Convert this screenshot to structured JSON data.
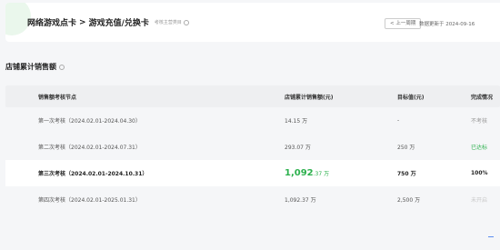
{
  "header": {
    "breadcrumb": [
      "网络游戏点卡",
      "游戏充值/兑换卡"
    ],
    "separator": ">",
    "tag": "考核主营类目",
    "prev_button": "< 上一周期",
    "update_text": "数据更新于 2024-09-16"
  },
  "section": {
    "title": "店铺累计销售额"
  },
  "table": {
    "columns": [
      "销售额考核节点",
      "店铺累计销售额(元)",
      "目标值(元)",
      "完成情况"
    ],
    "rows": [
      {
        "period": "第一次考核（2024.02.01-2024.04.30）",
        "sales": "14.15 万",
        "target": "-",
        "status": "不考核"
      },
      {
        "period": "第二次考核（2024.02.01-2024.07.31）",
        "sales": "293.07 万",
        "target": "250 万",
        "status": "已达标"
      },
      {
        "period": "第三次考核（2024.02.01-2024.10.31）",
        "sales_main": "1,092",
        "sales_decimal": ".37 万",
        "target": "750 万",
        "status": "100%"
      },
      {
        "period": "第四次考核（2024.02.01-2025.01.31）",
        "sales": "1,092.37 万",
        "target": "2,500 万",
        "status": "未开启"
      }
    ]
  },
  "colors": {
    "accent": "#2db14e",
    "background": "#f5f6f8"
  }
}
